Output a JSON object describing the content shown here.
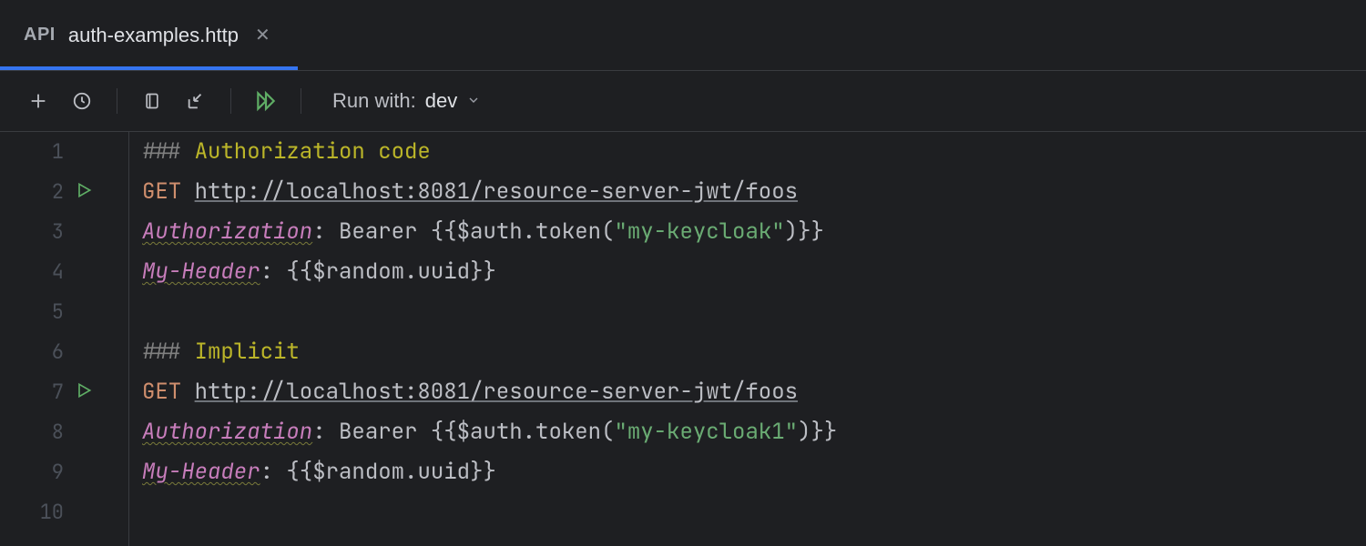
{
  "tab": {
    "badge": "API",
    "title": "auth-examples.http"
  },
  "toolbar": {
    "run_with_label": "Run with:",
    "env": "dev"
  },
  "editor": {
    "total_lines": 10,
    "run_markers": [
      2,
      7
    ],
    "lines": [
      {
        "n": 1,
        "spans": [
          {
            "cls": "tk-hash",
            "t": "### "
          },
          {
            "cls": "tk-comment",
            "t": "Authorization code"
          }
        ]
      },
      {
        "n": 2,
        "spans": [
          {
            "cls": "tk-method",
            "t": "GET "
          },
          {
            "cls": "tk-url",
            "t": "http://localhost:8081/resource-server-jwt/foos"
          }
        ]
      },
      {
        "n": 3,
        "spans": [
          {
            "cls": "tk-header",
            "t": "Authorization"
          },
          {
            "cls": "tk-colon",
            "t": ": "
          },
          {
            "cls": "tk-text",
            "t": "Bearer "
          },
          {
            "cls": "tk-brace",
            "t": "{{"
          },
          {
            "cls": "tk-var",
            "t": "$auth"
          },
          {
            "cls": "tk-dot",
            "t": "."
          },
          {
            "cls": "tk-fn",
            "t": "token("
          },
          {
            "cls": "tk-str",
            "t": "\"my-keycloak\""
          },
          {
            "cls": "tk-fn",
            "t": ")"
          },
          {
            "cls": "tk-brace",
            "t": "}}"
          }
        ]
      },
      {
        "n": 4,
        "spans": [
          {
            "cls": "tk-header",
            "t": "My-Header"
          },
          {
            "cls": "tk-colon",
            "t": ": "
          },
          {
            "cls": "tk-brace",
            "t": "{{"
          },
          {
            "cls": "tk-var",
            "t": "$random"
          },
          {
            "cls": "tk-dot",
            "t": "."
          },
          {
            "cls": "tk-fn",
            "t": "uuid"
          },
          {
            "cls": "tk-brace",
            "t": "}}"
          }
        ]
      },
      {
        "n": 5,
        "spans": []
      },
      {
        "n": 6,
        "spans": [
          {
            "cls": "tk-hash",
            "t": "### "
          },
          {
            "cls": "tk-comment",
            "t": "Implicit"
          }
        ]
      },
      {
        "n": 7,
        "spans": [
          {
            "cls": "tk-method",
            "t": "GET "
          },
          {
            "cls": "tk-url",
            "t": "http://localhost:8081/resource-server-jwt/foos"
          }
        ]
      },
      {
        "n": 8,
        "spans": [
          {
            "cls": "tk-header",
            "t": "Authorization"
          },
          {
            "cls": "tk-colon",
            "t": ": "
          },
          {
            "cls": "tk-text",
            "t": "Bearer "
          },
          {
            "cls": "tk-brace",
            "t": "{{"
          },
          {
            "cls": "tk-var",
            "t": "$auth"
          },
          {
            "cls": "tk-dot",
            "t": "."
          },
          {
            "cls": "tk-fn",
            "t": "token("
          },
          {
            "cls": "tk-str",
            "t": "\"my-keycloak1\""
          },
          {
            "cls": "tk-fn",
            "t": ")"
          },
          {
            "cls": "tk-brace",
            "t": "}}"
          }
        ]
      },
      {
        "n": 9,
        "spans": [
          {
            "cls": "tk-header",
            "t": "My-Header"
          },
          {
            "cls": "tk-colon",
            "t": ": "
          },
          {
            "cls": "tk-brace",
            "t": "{{"
          },
          {
            "cls": "tk-var",
            "t": "$random"
          },
          {
            "cls": "tk-dot",
            "t": "."
          },
          {
            "cls": "tk-fn",
            "t": "uuid"
          },
          {
            "cls": "tk-brace",
            "t": "}}"
          }
        ]
      },
      {
        "n": 10,
        "spans": []
      }
    ]
  }
}
